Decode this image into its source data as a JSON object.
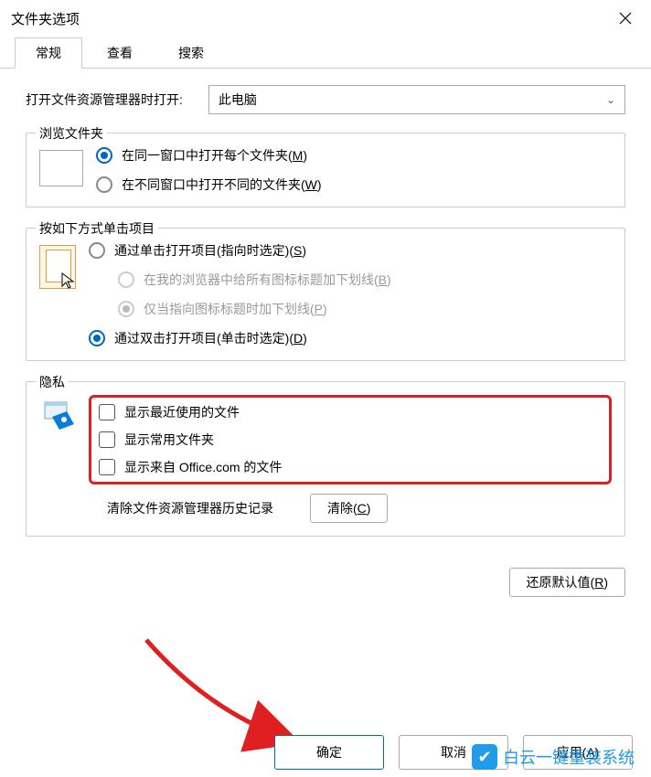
{
  "title": "文件夹选项",
  "tabs": {
    "general": "常规",
    "view": "查看",
    "search": "搜索"
  },
  "open": {
    "label": "打开文件资源管理器时打开:",
    "value": "此电脑"
  },
  "browse": {
    "legend": "浏览文件夹",
    "sameWindow": "在同一窗口中打开每个文件夹(",
    "sameWindowKey": "M",
    "diffWindow": "在不同窗口中打开不同的文件夹(",
    "diffWindowKey": "W",
    "close": ")"
  },
  "click": {
    "legend": "按如下方式单击项目",
    "single": "通过单击打开项目(指向时选定)(",
    "singleKey": "S",
    "browserUnderline": "在我的浏览器中给所有图标标题加下划线(",
    "browserUnderlineKey": "B",
    "pointUnderline": "仅当指向图标标题时加下划线(",
    "pointUnderlineKey": "P",
    "double": "通过双击打开项目(单击时选定)(",
    "doubleKey": "D",
    "close": ")"
  },
  "privacy": {
    "legend": "隐私",
    "recent": "显示最近使用的文件",
    "frequent": "显示常用文件夹",
    "office": "显示来自 Office.com 的文件",
    "clearLabel": "清除文件资源管理器历史记录",
    "clearBtn": "清除(",
    "clearKey": "C",
    "close": ")"
  },
  "restore": {
    "label": "还原默认值(",
    "key": "R",
    "close": ")"
  },
  "footer": {
    "ok": "确定",
    "cancel": "取消",
    "apply": "应用(",
    "applyKey": "A",
    "close": ")"
  },
  "watermark": "白云一键重装系统"
}
